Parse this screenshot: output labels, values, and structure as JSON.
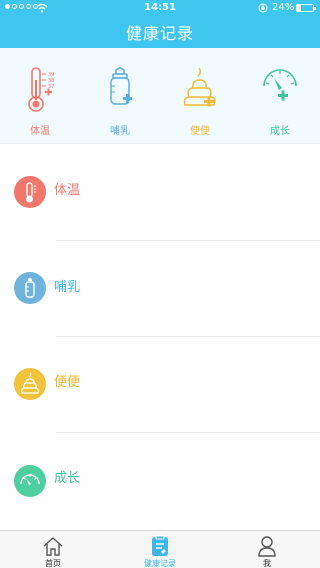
{
  "status": {
    "time": "14:51",
    "battery": "24%"
  },
  "header": {
    "title": "健康记录"
  },
  "quick": [
    {
      "label": "体温",
      "icon": "thermometer-icon",
      "color": "#f2776b"
    },
    {
      "label": "哺乳",
      "icon": "baby-bottle-icon",
      "color": "#5baee0"
    },
    {
      "label": "便便",
      "icon": "poop-icon",
      "color": "#f2b935"
    },
    {
      "label": "成长",
      "icon": "growth-gauge-icon",
      "color": "#3ec59b"
    }
  ],
  "records": [
    {
      "label": "体温",
      "icon": "thermometer-icon",
      "color": "#f2776b",
      "text_color": "#f2776b"
    },
    {
      "label": "哺乳",
      "icon": "baby-bottle-icon",
      "color": "#6fb3dd",
      "text_color": "#3fb6e6"
    },
    {
      "label": "便便",
      "icon": "poop-icon",
      "color": "#f3c23b",
      "text_color": "#f0b42a"
    },
    {
      "label": "成长",
      "icon": "growth-gauge-icon",
      "color": "#4fcf9f",
      "text_color": "#3ec59b"
    }
  ],
  "tabs": [
    {
      "label": "首页",
      "icon": "home-icon",
      "active": false
    },
    {
      "label": "健康记录",
      "icon": "health-record-icon",
      "active": true
    },
    {
      "label": "我",
      "icon": "profile-icon",
      "active": false
    }
  ]
}
